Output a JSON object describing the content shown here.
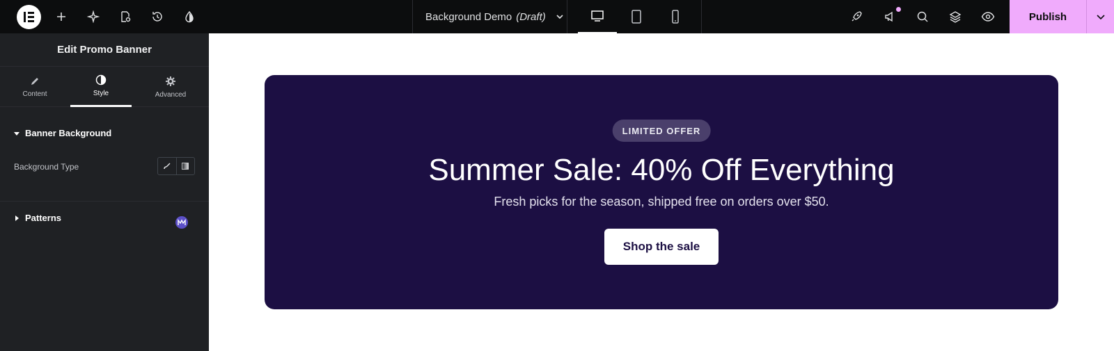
{
  "topbar": {
    "document_title": "Background Demo",
    "document_status": "(Draft)",
    "publish_label": "Publish"
  },
  "panel": {
    "title": "Edit Promo Banner",
    "tabs": [
      {
        "label": "Content",
        "icon": "pencil-icon",
        "active": false
      },
      {
        "label": "Style",
        "icon": "half-circle-icon",
        "active": true
      },
      {
        "label": "Advanced",
        "icon": "gear-icon",
        "active": false
      }
    ],
    "sections": [
      {
        "label": "Banner Background",
        "expanded": true
      },
      {
        "label": "Patterns",
        "expanded": false
      }
    ],
    "background_type_label": "Background Type",
    "background_type_options": [
      "classic-brush-icon",
      "gradient-icon"
    ]
  },
  "banner": {
    "badge": "LIMITED OFFER",
    "headline": "Summer Sale: 40% Off Everything",
    "subline": "Fresh picks for the season, shipped free on orders over $50.",
    "cta_label": "Shop the sale"
  },
  "colors": {
    "topbar_bg": "#0c0d0e",
    "panel_bg": "#1f2124",
    "publish_bg": "#f0abfc",
    "banner_bg": "#1c0f43",
    "badge_bg": "#4a3f6b"
  }
}
